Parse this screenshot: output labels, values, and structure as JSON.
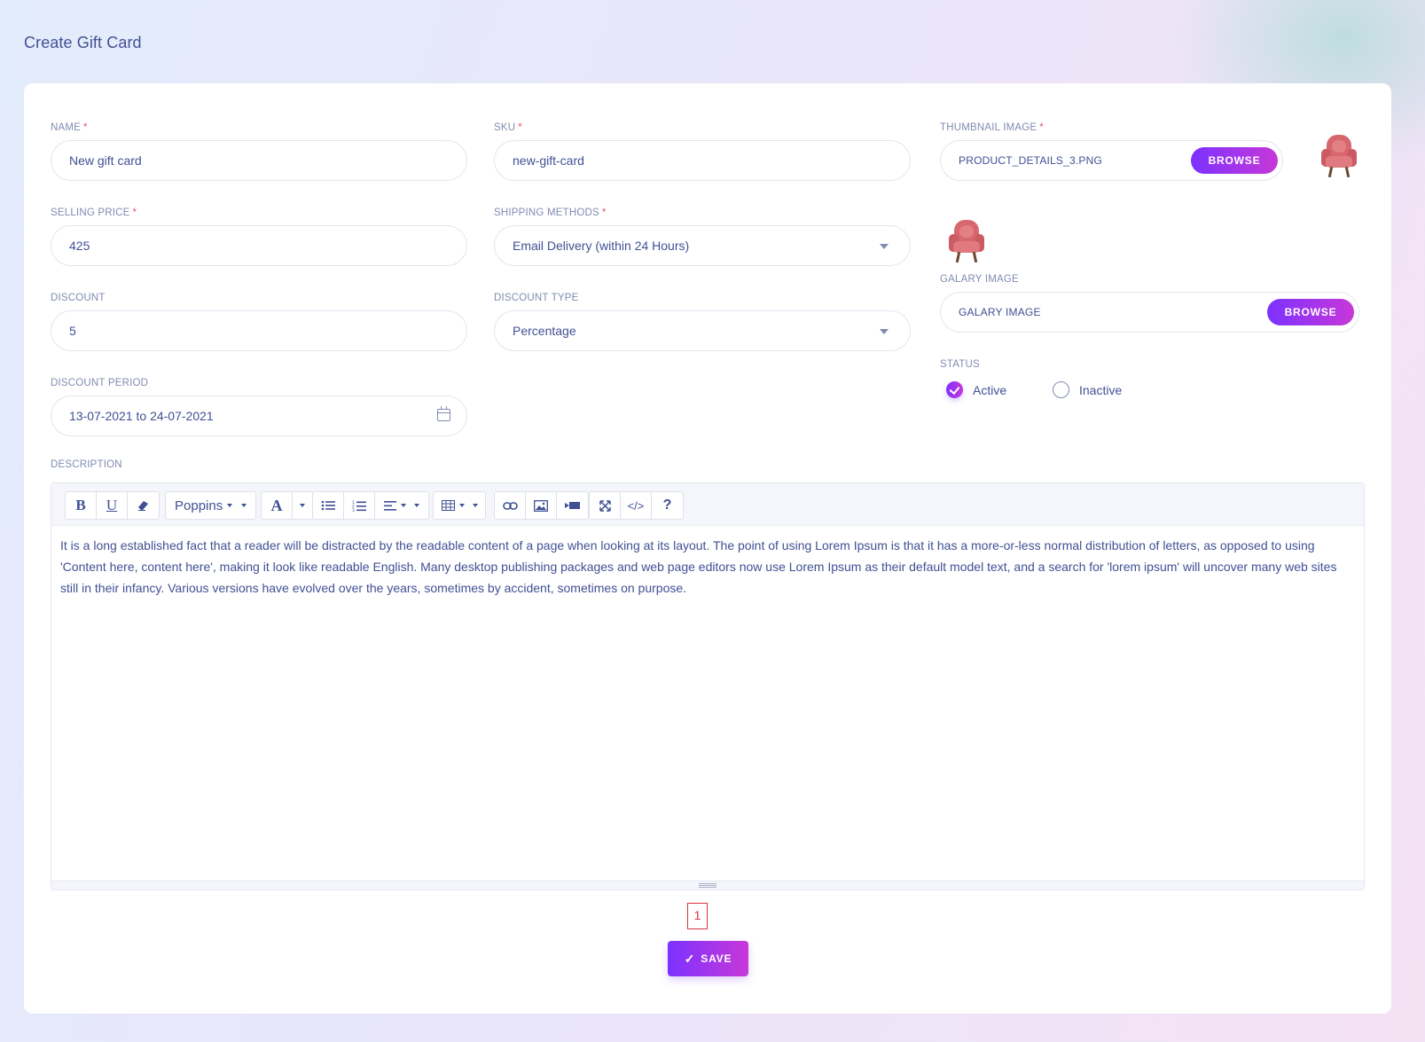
{
  "page": {
    "title": "Create Gift Card"
  },
  "form": {
    "name": {
      "label": "NAME",
      "required": "*",
      "value": "New gift card"
    },
    "sku": {
      "label": "SKU",
      "required": "*",
      "value": "new-gift-card"
    },
    "selling_price": {
      "label": "SELLING PRICE",
      "required": "*",
      "value": "425"
    },
    "shipping_methods": {
      "label": "SHIPPING METHODS",
      "required": "*",
      "value": "Email Delivery (within 24 Hours)"
    },
    "discount": {
      "label": "DISCOUNT",
      "value": "5"
    },
    "discount_type": {
      "label": "DISCOUNT TYPE",
      "value": "Percentage"
    },
    "discount_period": {
      "label": "DISCOUNT PERIOD",
      "value": "13-07-2021 to 24-07-2021"
    },
    "thumbnail_image": {
      "label": "THUMBNAIL IMAGE",
      "required": "*",
      "file_name": "PRODUCT_DETAILS_3.PNG",
      "browse_label": "BROWSE"
    },
    "gallery_image": {
      "label": "GALARY IMAGE",
      "file_name": "GALARY IMAGE",
      "browse_label": "BROWSE"
    },
    "status": {
      "label": "STATUS",
      "options": [
        {
          "label": "Active",
          "checked": true
        },
        {
          "label": "Inactive",
          "checked": false
        }
      ]
    },
    "description": {
      "label": "DESCRIPTION",
      "toolbar": {
        "font_name": "Poppins",
        "bold": "B",
        "underline": "U",
        "font_color": "A",
        "code_view": "</>",
        "help": "?"
      },
      "content": "It is a long established fact that a reader will be distracted by the readable content of a page when looking at its layout. The point of using Lorem Ipsum is that it has a more-or-less normal distribution of letters, as opposed to using 'Content here, content here', making it look like readable English. Many desktop publishing packages and web page editors now use Lorem Ipsum as their default model text, and a search for 'lorem ipsum' will uncover many web sites still in their infancy. Various versions have evolved over the years, sometimes by accident, sometimes on purpose."
    }
  },
  "pagination": {
    "current": "1"
  },
  "actions": {
    "save_label": "SAVE",
    "save_icon": "✓"
  },
  "colors": {
    "accent_start": "#7c32ff",
    "accent_end": "#c738d8",
    "text": "#415094",
    "label": "#828bb2",
    "required": "#e0566b"
  }
}
